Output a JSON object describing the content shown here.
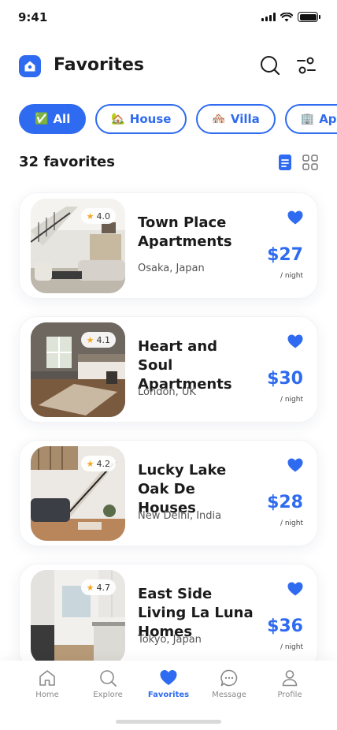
{
  "status_bar": {
    "time": "9:41"
  },
  "header": {
    "title": "Favorites",
    "icons": [
      "home-logo-icon",
      "search-icon",
      "filter-icon"
    ]
  },
  "filters": [
    {
      "emoji": "✅",
      "label": "All",
      "active": true
    },
    {
      "emoji": "🏡",
      "label": "House",
      "active": false
    },
    {
      "emoji": "🏘️",
      "label": "Villa",
      "active": false
    },
    {
      "emoji": "🏢",
      "label": "Apartments",
      "active": false
    }
  ],
  "summary": {
    "count_label": "32 favorites",
    "view_mode": "list"
  },
  "listings": [
    {
      "title": "Town Place Apartments",
      "location": "Osaka, Japan",
      "rating": "4.0",
      "price": "$27",
      "per": "/ night",
      "favorited": true
    },
    {
      "title": "Heart and Soul Apartments",
      "location": "London, UK",
      "rating": "4.1",
      "price": "$30",
      "per": "/ night",
      "favorited": true
    },
    {
      "title": "Lucky Lake Oak De  Houses",
      "location": "New Delhi, India",
      "rating": "4.2",
      "price": "$28",
      "per": "/ night",
      "favorited": true
    },
    {
      "title": "East Side Living La Luna Homes",
      "location": "Tokyo, Japan",
      "rating": "4.7",
      "price": "$36",
      "per": "/ night",
      "favorited": true
    }
  ],
  "bottom_nav": [
    {
      "label": "Home",
      "icon": "home-icon",
      "active": false
    },
    {
      "label": "Explore",
      "icon": "search-icon",
      "active": false
    },
    {
      "label": "Favorites",
      "icon": "heart-icon",
      "active": true
    },
    {
      "label": "Message",
      "icon": "message-icon",
      "active": false
    },
    {
      "label": "Profile",
      "icon": "profile-icon",
      "active": false
    }
  ],
  "colors": {
    "accent": "#2f6bf0",
    "star": "#f5a623",
    "text": "#1b1b1b"
  }
}
